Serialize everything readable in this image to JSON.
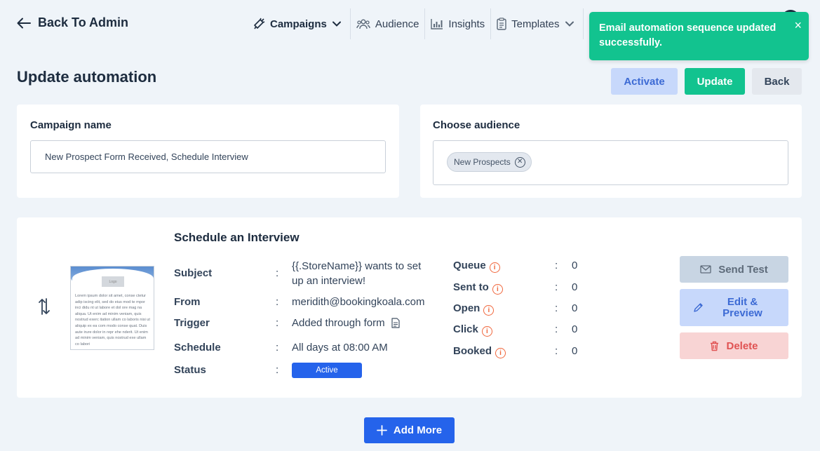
{
  "header": {
    "back_label": "Back To Admin",
    "nav": [
      {
        "label": "Campaigns",
        "icon": "megaphone-icon",
        "active": true
      },
      {
        "label": "Audience",
        "icon": "users-icon"
      },
      {
        "label": "Insights",
        "icon": "bar-chart-icon"
      },
      {
        "label": "Templates",
        "icon": "clipboard-icon"
      }
    ]
  },
  "toast": {
    "message": "Email automation sequence updated successfully.",
    "close": "×",
    "color": "#12c38f"
  },
  "page": {
    "title": "Update automation",
    "actions": {
      "activate": "Activate",
      "update": "Update",
      "back": "Back"
    }
  },
  "campaign": {
    "label": "Campaign name",
    "value": "New Prospect Form Received, Schedule Interview"
  },
  "audience": {
    "label": "Choose audience",
    "chips": [
      "New Prospects"
    ]
  },
  "step": {
    "title": "Schedule an Interview",
    "thumbnail": {
      "logo_text": "Logo",
      "body_text": "Lorem ipsum dolor sit amet, conse ctetur adip iscing elit, sed do eius mod te mpor inci didu nt ut labore et dol ore mag na aliqua. Ut enim ad minim veniam, quis nostrud exerc itation ullam co laboris nisi ut aliquip ex ea com modo conse quat. Duis aute irure dolor in repr ehe nderit. Ut enim ad minim veniam, quis nostrud exe ullam co labori"
    },
    "fields": {
      "subject": {
        "label": "Subject",
        "value": "{{.StoreName}} wants to set up an interview!"
      },
      "from": {
        "label": "From",
        "value": "meridith@bookingkoala.com"
      },
      "trigger": {
        "label": "Trigger",
        "value": "Added through form"
      },
      "schedule": {
        "label": "Schedule",
        "value": "All days at 08:00 AM"
      },
      "status": {
        "label": "Status",
        "value": "Active"
      }
    },
    "stats": [
      {
        "label": "Queue",
        "value": "0"
      },
      {
        "label": "Sent to",
        "value": "0"
      },
      {
        "label": "Open",
        "value": "0"
      },
      {
        "label": "Click",
        "value": "0"
      },
      {
        "label": "Booked",
        "value": "0"
      }
    ],
    "colon": ":",
    "info_glyph": "i",
    "buttons": {
      "send_test": "Send Test",
      "edit_line1": "Edit &",
      "edit_line2": "Preview",
      "delete": "Delete"
    }
  },
  "add_more": "Add More"
}
